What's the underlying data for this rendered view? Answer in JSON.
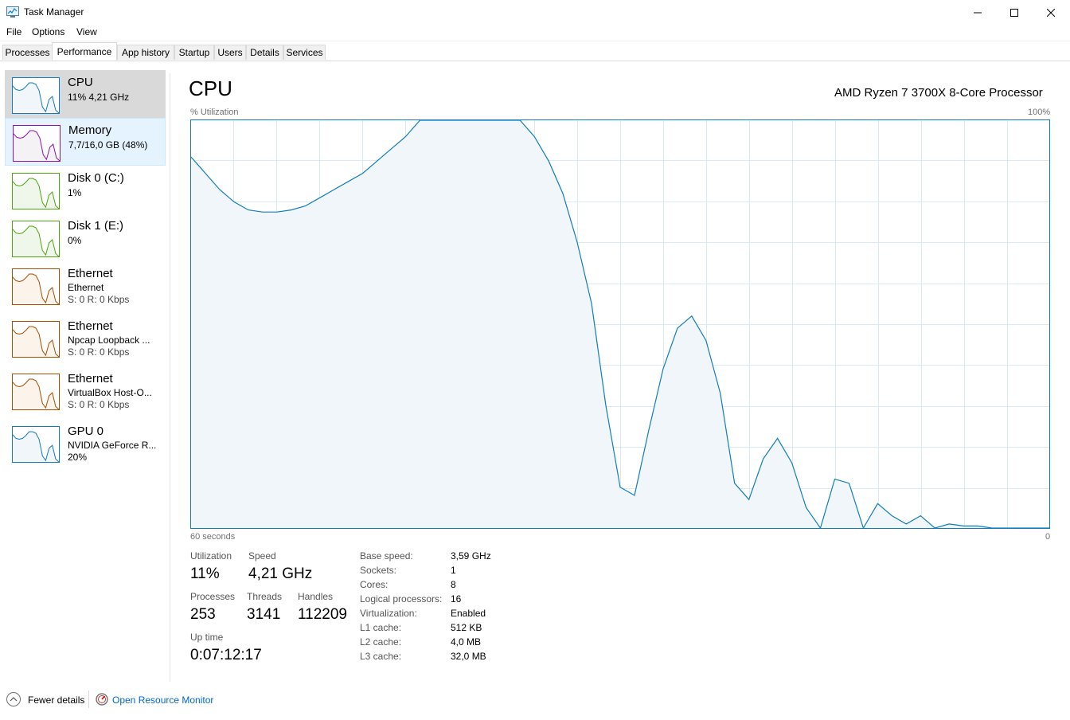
{
  "window": {
    "title": "Task Manager"
  },
  "menu": [
    "File",
    "Options",
    "View"
  ],
  "tabs": [
    {
      "label": "Processes"
    },
    {
      "label": "Performance",
      "active": true
    },
    {
      "label": "App history"
    },
    {
      "label": "Startup"
    },
    {
      "label": "Users"
    },
    {
      "label": "Details"
    },
    {
      "label": "Services"
    }
  ],
  "sidebar": [
    {
      "title": "CPU",
      "line1": "11% 4,21 GHz",
      "color": "#117dbb",
      "fill": "#f1f6fa"
    },
    {
      "title": "Memory",
      "line1": "7,7/16,0 GB (48%)",
      "color": "#8b12ae",
      "fill": "#f4f2f4"
    },
    {
      "title": "Disk 0 (C:)",
      "line1": "1%",
      "color": "#4da60c",
      "fill": "#eff7eb"
    },
    {
      "title": "Disk 1 (E:)",
      "line1": "0%",
      "color": "#4da60c",
      "fill": "#eff7eb"
    },
    {
      "title": "Ethernet",
      "line1": "Ethernet",
      "line2": "S: 0 R: 0 Kbps",
      "color": "#a74f01",
      "fill": "#fcf3eb"
    },
    {
      "title": "Ethernet",
      "line1": "Npcap Loopback ...",
      "line2": "S: 0 R: 0 Kbps",
      "color": "#a74f01",
      "fill": "#fcf3eb"
    },
    {
      "title": "Ethernet",
      "line1": "VirtualBox Host-O...",
      "line2": "S: 0 R: 0 Kbps",
      "color": "#a74f01",
      "fill": "#fcf3eb"
    },
    {
      "title": "GPU 0",
      "line1": "NVIDIA GeForce R...",
      "line2": "20%",
      "color": "#117dbb",
      "fill": "#f1f6fa"
    }
  ],
  "main": {
    "title": "CPU",
    "processor": "AMD Ryzen 7 3700X 8-Core Processor",
    "graph_ylabel": "% Utilization",
    "graph_ymax": "100%",
    "graph_xleft": "60 seconds",
    "graph_xright": "0",
    "graph_color": "#117dbb",
    "graph_fill": "#f1f6fa",
    "graph_grid": "#d9eaf4"
  },
  "chart_data": {
    "type": "area",
    "x": [
      60,
      59,
      58,
      57,
      56,
      55,
      54,
      53,
      52,
      51,
      50,
      49,
      48,
      47,
      46,
      45,
      44,
      43,
      42,
      41,
      40,
      39,
      38,
      37,
      36,
      35,
      34,
      33,
      32,
      31,
      30,
      29,
      28,
      27,
      26,
      25,
      24,
      23,
      22,
      21,
      20,
      19,
      18,
      17,
      16,
      15,
      14,
      13,
      12,
      11,
      10,
      9,
      8,
      7,
      6,
      5,
      4,
      3,
      2,
      1,
      0
    ],
    "values": [
      91,
      87,
      83,
      80,
      78,
      77.5,
      77.5,
      78,
      79,
      81,
      83,
      85,
      87,
      90,
      93,
      96,
      100,
      100,
      100,
      100,
      100,
      100,
      100,
      100,
      96,
      90,
      82,
      70,
      55,
      30,
      10,
      8,
      24,
      39,
      49,
      52,
      46,
      33,
      11,
      7,
      17,
      22,
      16,
      5,
      0,
      12,
      11,
      0,
      6,
      3,
      1,
      3,
      0,
      1,
      0.5,
      0.5,
      0,
      0,
      0,
      0,
      0
    ],
    "ylim": [
      0,
      100
    ],
    "xlabel": "60 seconds",
    "ylabel": "% Utilization"
  },
  "stats": {
    "utilization_label": "Utilization",
    "utilization": "11%",
    "speed_label": "Speed",
    "speed": "4,21 GHz",
    "processes_label": "Processes",
    "processes": "253",
    "threads_label": "Threads",
    "threads": "3141",
    "handles_label": "Handles",
    "handles": "112209",
    "uptime_label": "Up time",
    "uptime": "0:07:12:17"
  },
  "specs": [
    {
      "label": "Base speed:",
      "value": "3,59 GHz"
    },
    {
      "label": "Sockets:",
      "value": "1"
    },
    {
      "label": "Cores:",
      "value": "8"
    },
    {
      "label": "Logical processors:",
      "value": "16"
    },
    {
      "label": "Virtualization:",
      "value": "Enabled"
    },
    {
      "label": "L1 cache:",
      "value": "512 KB"
    },
    {
      "label": "L2 cache:",
      "value": "4,0 MB"
    },
    {
      "label": "L3 cache:",
      "value": "32,0 MB"
    }
  ],
  "footer": {
    "fewer_details": "Fewer details",
    "resource_monitor": "Open Resource Monitor"
  }
}
